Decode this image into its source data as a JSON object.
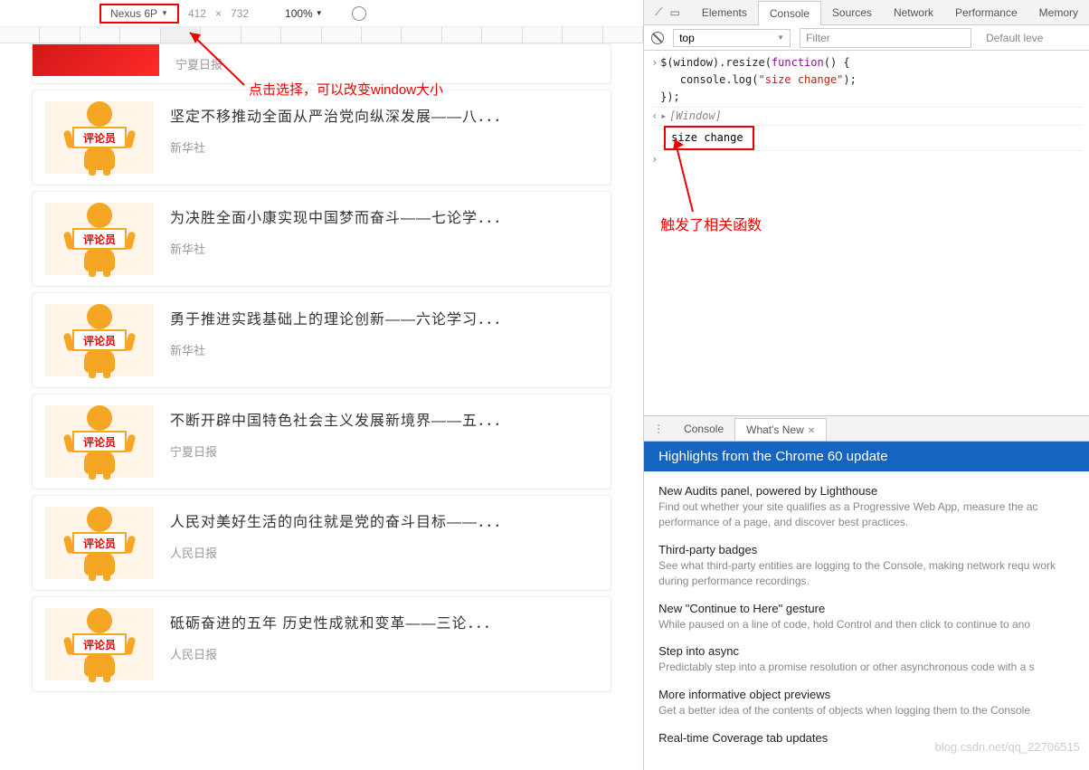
{
  "toolbar": {
    "device": "Nexus 6P",
    "width": "412",
    "times": "×",
    "height": "732",
    "zoom": "100%"
  },
  "annotations": {
    "device_hint": "点击选择，可以改变window大小",
    "trigger_hint": "触发了相关函数"
  },
  "list": {
    "commenter_label": "评论员",
    "items": [
      {
        "title": "",
        "source": "宁夏日报",
        "top": true
      },
      {
        "title": "坚定不移推动全面从严治党向纵深发展——八．．．",
        "source": "新华社"
      },
      {
        "title": "为决胜全面小康实现中国梦而奋斗——七论学．．．",
        "source": "新华社"
      },
      {
        "title": "勇于推进实践基础上的理论创新——六论学习．．．",
        "source": "新华社"
      },
      {
        "title": "不断开辟中国特色社会主义发展新境界——五．．．",
        "source": "宁夏日报"
      },
      {
        "title": "人民对美好生活的向往就是党的奋斗目标——．．．",
        "source": "人民日报"
      },
      {
        "title": "砥砺奋进的五年  历史性成就和变革——三论．．．",
        "source": "人民日报"
      }
    ]
  },
  "devtools": {
    "tabs": [
      "Elements",
      "Console",
      "Sources",
      "Network",
      "Performance",
      "Memory"
    ],
    "active_tab": "Console",
    "console_toolbar": {
      "context": "top",
      "filter_placeholder": "Filter",
      "level": "Default leve"
    },
    "console_lines": {
      "l1a": "$(window).resize(",
      "l1b": "function",
      "l1c": "() {",
      "l2a": "   console.log(",
      "l2b": "\"size change\"",
      "l2c": ");",
      "l3": "});",
      "l4": "[Window]",
      "l5": "size change"
    },
    "drawer": {
      "tabs": [
        "Console",
        "What's New"
      ],
      "active": "What's New",
      "banner": "Highlights from the Chrome 60 update",
      "items": [
        {
          "t": "New Audits panel, powered by Lighthouse",
          "d": "Find out whether your site qualifies as a Progressive Web App, measure the ac performance of a page, and discover best practices."
        },
        {
          "t": "Third-party badges",
          "d": "See what third-party entities are logging to the Console, making network requ work during performance recordings."
        },
        {
          "t": "New \"Continue to Here\" gesture",
          "d": "While paused on a line of code, hold Control and then click to continue to ano"
        },
        {
          "t": "Step into async",
          "d": "Predictably step into a promise resolution or other asynchronous code with a s"
        },
        {
          "t": "More informative object previews",
          "d": "Get a better idea of the contents of objects when logging them to the Console"
        },
        {
          "t": "Real-time Coverage tab updates",
          "d": ""
        }
      ]
    }
  },
  "watermark": "blog.csdn.net/qq_22706515"
}
